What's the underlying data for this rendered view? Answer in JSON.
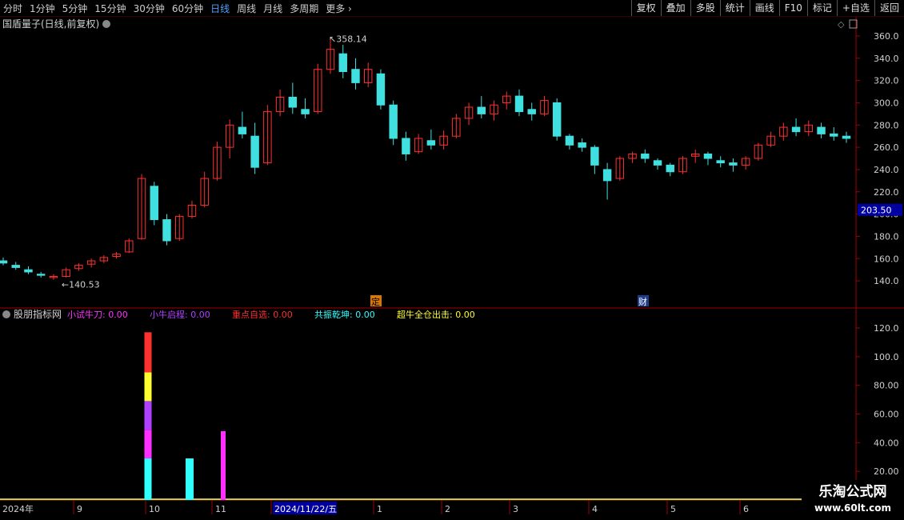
{
  "toolbar": {
    "periods": [
      "分时",
      "1分钟",
      "5分钟",
      "15分钟",
      "30分钟",
      "60分钟",
      "日线",
      "周线",
      "月线",
      "多周期",
      "更多"
    ],
    "active_period": "日线",
    "buttons": [
      "复权",
      "叠加",
      "多股",
      "统计",
      "画线",
      "F10",
      "标记",
      "+自选",
      "返回"
    ]
  },
  "main_panel": {
    "title": "国盾量子(日线,前复权)",
    "price_ticks": [
      "360.0",
      "340.0",
      "320.0",
      "300.0",
      "280.0",
      "260.0",
      "240.0",
      "220.0",
      "200.0",
      "180.0",
      "160.0",
      "140.0"
    ],
    "high_label": "358.14",
    "low_label": "140.53",
    "current_price_tag": "203.50",
    "event_markers": [
      {
        "text": "定",
        "bg": "#d87800",
        "fg": "#000000"
      },
      {
        "text": "财",
        "bg": "#1e3c8c",
        "fg": "#ffffff"
      }
    ]
  },
  "indicator_panel": {
    "title": "股朋指标网",
    "items": [
      {
        "label": "小试牛刀:",
        "value": "0.00",
        "color": "#ff30ff"
      },
      {
        "label": "小牛启程:",
        "value": "0.00",
        "color": "#b040ff"
      },
      {
        "label": "重点自选:",
        "value": "0.00",
        "color": "#ff3030"
      },
      {
        "label": "共振乾坤:",
        "value": "0.00",
        "color": "#30ffff"
      },
      {
        "label": "超牛全仓出击:",
        "value": "0.00",
        "color": "#ffff30"
      }
    ],
    "axis_ticks": [
      "120.0",
      "100.0",
      "80.00",
      "60.00",
      "40.00",
      "20.00"
    ]
  },
  "x_axis": {
    "labels": [
      "2024年",
      "9",
      "10",
      "11",
      "2024/11/22/五",
      "1",
      "2",
      "3",
      "4",
      "5",
      "6"
    ],
    "highlight_label": "2024/11/22/五"
  },
  "watermark": {
    "title": "乐淘公式网",
    "url": "www.60lt.com"
  },
  "colors": {
    "up": "#ff3030",
    "down": "#40e0e0",
    "axis": "#a00000",
    "text": "#d0d0d0",
    "price_tag_bg": "#0000a0"
  },
  "chart_data": {
    "type": "candlestick",
    "candles_ohlc_sample": [
      [
        158,
        161,
        154,
        156
      ],
      [
        154,
        157,
        150,
        152
      ],
      [
        150,
        153,
        146,
        148
      ],
      [
        146,
        148,
        143,
        145
      ],
      [
        143,
        146,
        141,
        144
      ],
      [
        144,
        152,
        143,
        150
      ],
      [
        151,
        156,
        149,
        154
      ],
      [
        155,
        160,
        152,
        158
      ],
      [
        158,
        163,
        156,
        161
      ],
      [
        162,
        166,
        160,
        164
      ],
      [
        166,
        178,
        165,
        176
      ],
      [
        178,
        236,
        177,
        232
      ],
      [
        225,
        229,
        190,
        195
      ],
      [
        195,
        200,
        172,
        176
      ],
      [
        178,
        200,
        176,
        198
      ],
      [
        198,
        212,
        196,
        208
      ],
      [
        208,
        238,
        206,
        232
      ],
      [
        232,
        265,
        230,
        260
      ],
      [
        260,
        285,
        250,
        280
      ],
      [
        278,
        292,
        268,
        272
      ],
      [
        270,
        282,
        236,
        242
      ],
      [
        246,
        298,
        244,
        292
      ],
      [
        292,
        312,
        288,
        305
      ],
      [
        305,
        318,
        290,
        296
      ],
      [
        294,
        304,
        286,
        290
      ],
      [
        292,
        335,
        290,
        330
      ],
      [
        330,
        358,
        326,
        348
      ],
      [
        344,
        352,
        322,
        328
      ],
      [
        330,
        340,
        312,
        318
      ],
      [
        318,
        336,
        314,
        330
      ],
      [
        326,
        330,
        294,
        298
      ],
      [
        298,
        302,
        262,
        268
      ],
      [
        268,
        274,
        248,
        254
      ],
      [
        256,
        272,
        254,
        268
      ],
      [
        266,
        276,
        258,
        262
      ],
      [
        262,
        275,
        258,
        270
      ],
      [
        270,
        290,
        268,
        286
      ],
      [
        286,
        300,
        280,
        296
      ],
      [
        296,
        306,
        286,
        290
      ],
      [
        290,
        302,
        284,
        298
      ],
      [
        300,
        310,
        294,
        306
      ],
      [
        306,
        312,
        288,
        292
      ],
      [
        294,
        300,
        284,
        290
      ],
      [
        290,
        306,
        288,
        302
      ],
      [
        300,
        304,
        266,
        270
      ],
      [
        270,
        272,
        258,
        262
      ],
      [
        264,
        268,
        256,
        260
      ],
      [
        260,
        262,
        236,
        244
      ],
      [
        240,
        246,
        213,
        230
      ],
      [
        232,
        252,
        230,
        250
      ],
      [
        250,
        256,
        246,
        254
      ],
      [
        254,
        258,
        246,
        250
      ],
      [
        248,
        250,
        240,
        244
      ],
      [
        244,
        246,
        234,
        238
      ],
      [
        238,
        252,
        236,
        250
      ],
      [
        252,
        258,
        246,
        254
      ],
      [
        254,
        256,
        244,
        250
      ],
      [
        248,
        252,
        242,
        246
      ],
      [
        246,
        250,
        238,
        244
      ],
      [
        244,
        252,
        240,
        250
      ],
      [
        250,
        264,
        248,
        262
      ],
      [
        262,
        274,
        260,
        270
      ],
      [
        270,
        282,
        266,
        278
      ],
      [
        278,
        286,
        270,
        274
      ],
      [
        274,
        284,
        270,
        280
      ],
      [
        278,
        282,
        268,
        272
      ],
      [
        272,
        278,
        266,
        270
      ],
      [
        270,
        274,
        264,
        268
      ]
    ],
    "volume_signals": [
      {
        "category": "10",
        "values": {
          "共振乾坤": 29,
          "小试牛刀": 20,
          "小牛启程": 20,
          "超牛全仓出击": 20,
          "重点自选": 28
        }
      },
      {
        "category": "10",
        "values": {
          "共振乾坤": 29
        }
      },
      {
        "category": "11",
        "values": {
          "小试牛刀": 48
        }
      }
    ],
    "ylim_price": [
      130,
      365
    ],
    "ylim_indicator": [
      0,
      125
    ]
  }
}
